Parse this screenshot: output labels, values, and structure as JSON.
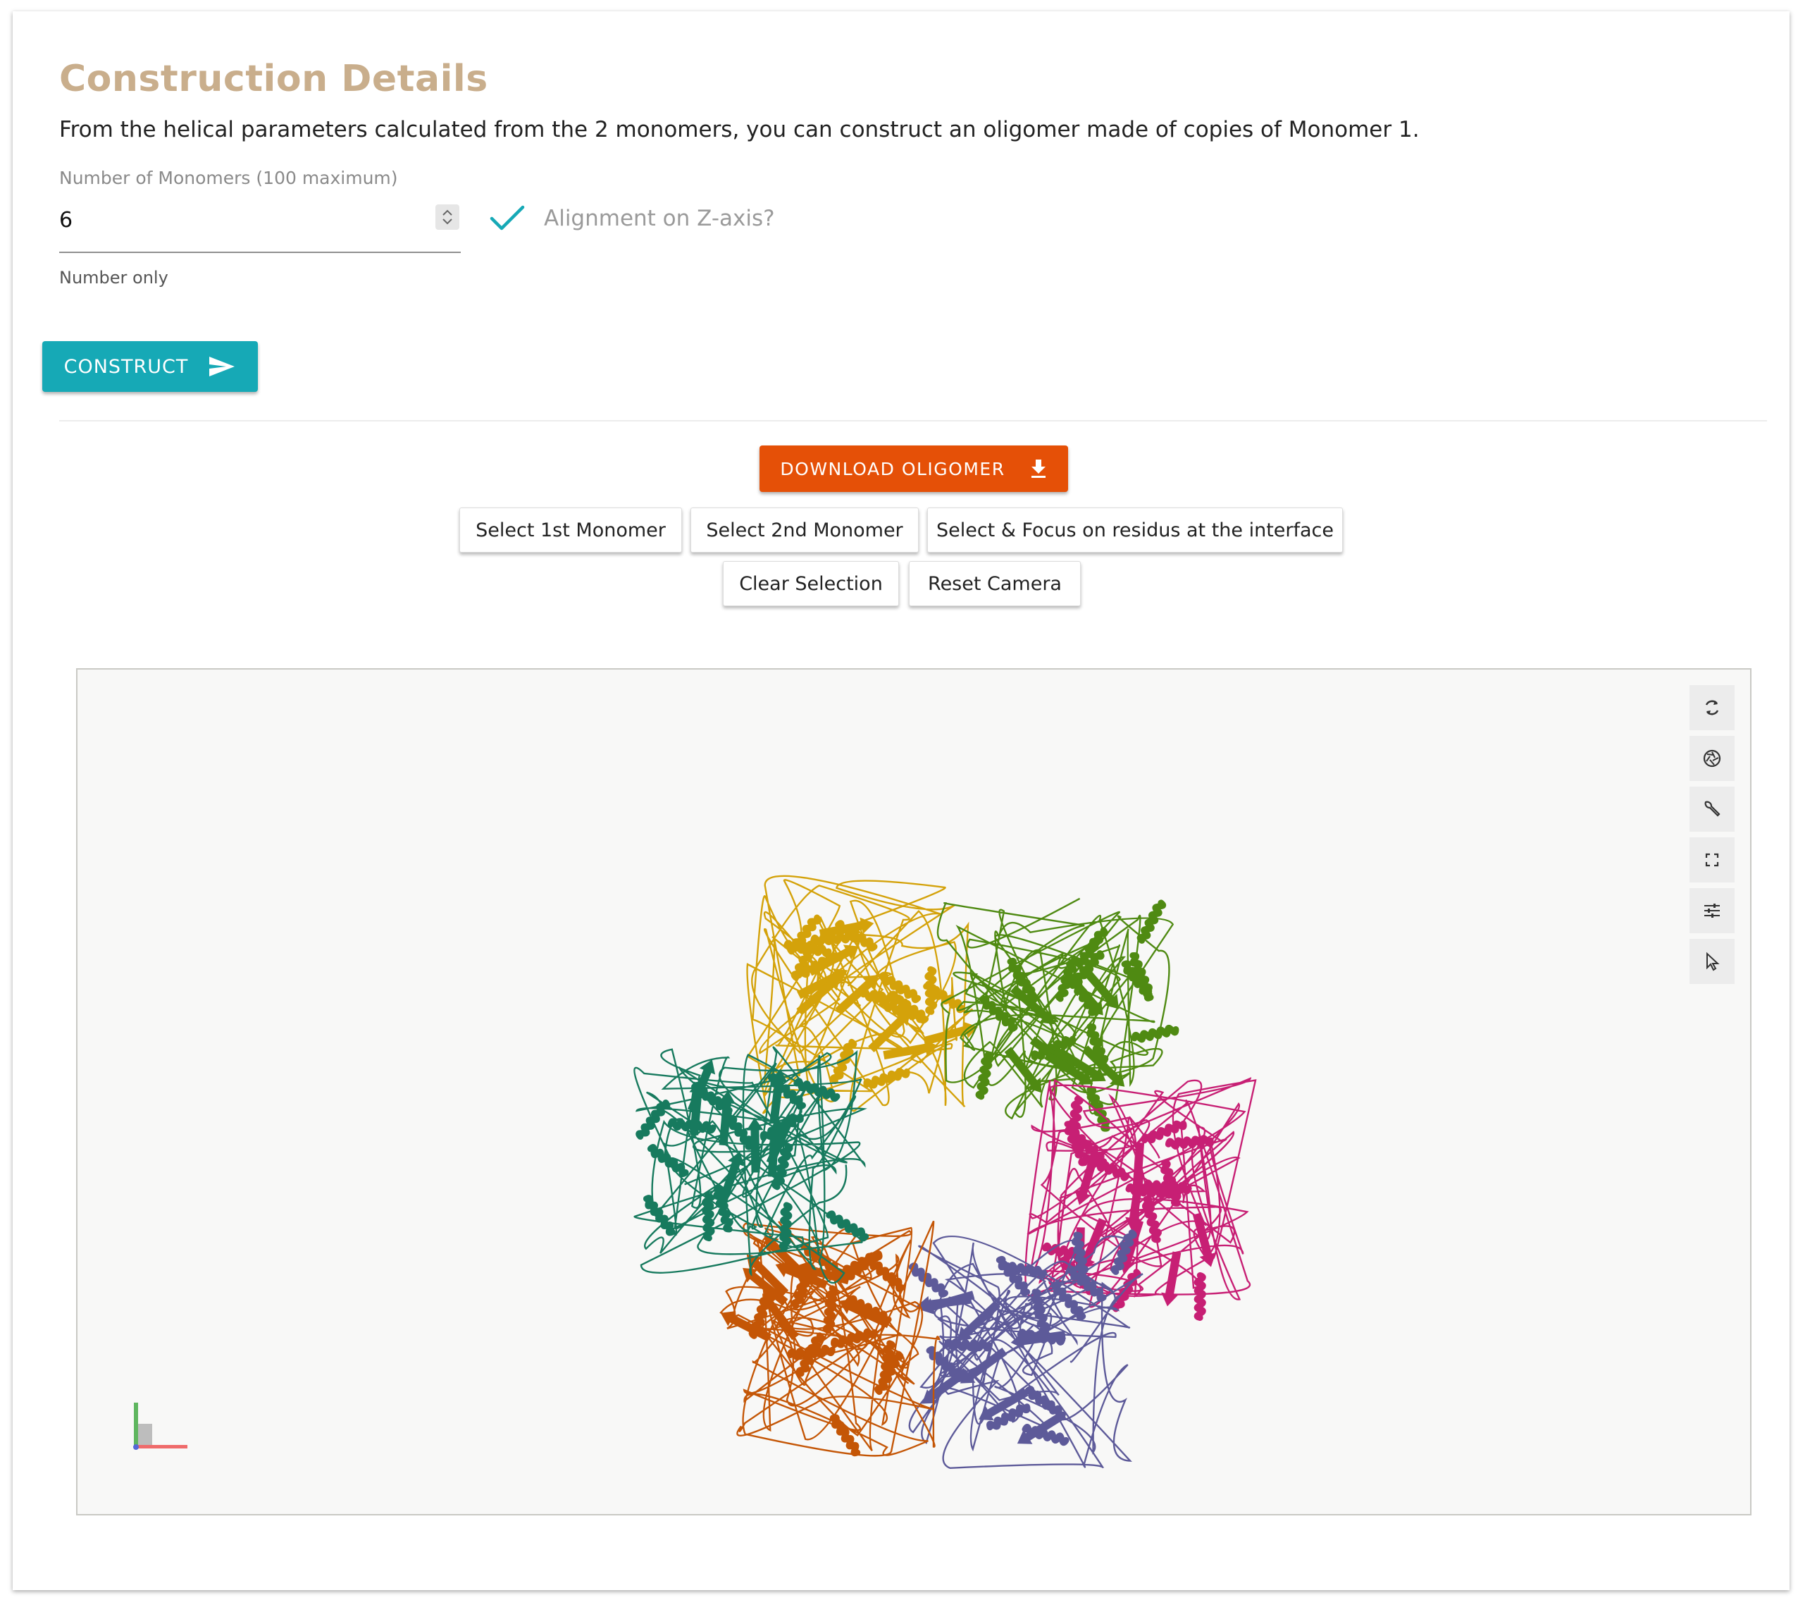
{
  "header": {
    "title": "Construction Details",
    "intro": "From the helical parameters calculated from the 2 monomers, you can construct an oligomer made of copies of Monomer 1."
  },
  "form": {
    "monomers_label": "Number of Monomers (100 maximum)",
    "monomers_value": "6",
    "helper": "Number only",
    "alignment_label": "Alignment on Z-axis?",
    "alignment_checked": true,
    "construct_label": "CONSTRUCT"
  },
  "actions": {
    "download_label": "DOWNLOAD OLIGOMER",
    "select_first": "Select 1st Monomer",
    "select_second": "Select 2nd Monomer",
    "select_interface": "Select & Focus on residus at the interface",
    "clear_selection": "Clear Selection",
    "reset_camera": "Reset Camera"
  },
  "viewer": {
    "tools": [
      "refresh-icon",
      "screenshot-icon",
      "wrench-icon",
      "expand-icon",
      "sliders-icon",
      "pointer-icon"
    ],
    "monomer_colors": [
      "#d4a20a",
      "#4f8a12",
      "#c71f74",
      "#5d5a99",
      "#c45606",
      "#177a5e"
    ]
  },
  "colors": {
    "title": "#c9ae8c",
    "construct_button": "#16a9b6",
    "download_button": "#e55007",
    "checkmark": "#16a9b6"
  }
}
